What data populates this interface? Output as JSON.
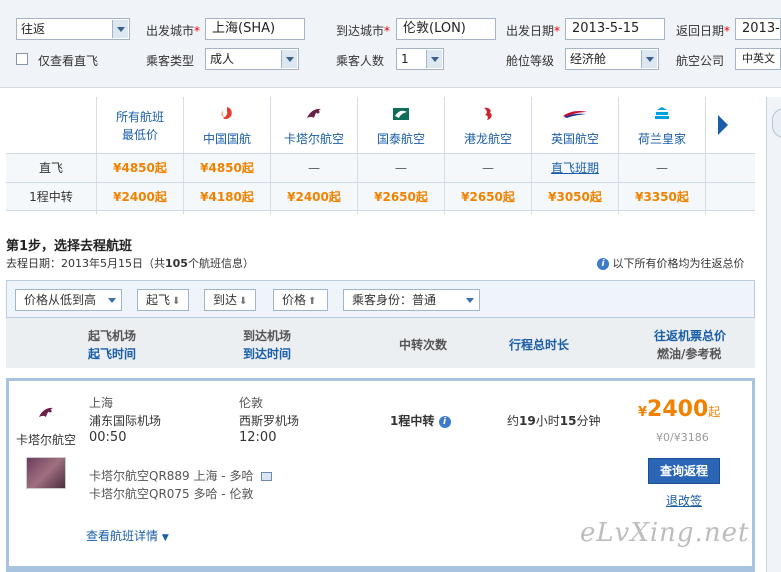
{
  "search": {
    "trip_type": "往返",
    "direct_only_label": "仅查看直飞",
    "depart_city_label": "出发城市",
    "depart_city_value": "上海(SHA)",
    "arrive_city_label": "到达城市",
    "arrive_city_value": "伦敦(LON)",
    "depart_date_label": "出发日期",
    "depart_date_value": "2013-5-15",
    "return_date_label": "返回日期",
    "return_date_value": "2013-5",
    "passenger_type_label": "乘客类型",
    "passenger_type_value": "成人",
    "passenger_count_label": "乘客人数",
    "passenger_count_value": "1",
    "cabin_label": "舱位等级",
    "cabin_value": "经济舱",
    "airline_label": "航空公司",
    "airline_value": "中英文"
  },
  "matrix": {
    "first_col_line1": "所有航班",
    "first_col_line2": "最低价",
    "row_direct": "直飞",
    "row_transfer": "1程中转",
    "all_direct": "¥4850起",
    "all_transfer": "¥2400起",
    "airlines": [
      {
        "name": "中国国航",
        "icon": "air-china-icon",
        "direct": "¥4850起",
        "transfer": "¥4180起"
      },
      {
        "name": "卡塔尔航空",
        "icon": "qatar-icon",
        "direct": "—",
        "transfer": "¥2400起"
      },
      {
        "name": "国泰航空",
        "icon": "cathay-icon",
        "direct": "—",
        "transfer": "¥2650起"
      },
      {
        "name": "港龙航空",
        "icon": "dragonair-icon",
        "direct": "—",
        "transfer": "¥2650起"
      },
      {
        "name": "英国航空",
        "icon": "british-airways-icon",
        "direct": "直飞班期",
        "transfer": "¥3050起"
      },
      {
        "name": "荷兰皇家",
        "icon": "klm-icon",
        "direct": "—",
        "transfer": "¥3350起"
      }
    ]
  },
  "step": {
    "title": "第1步，选择去程航班",
    "date_prefix": "去程日期：2013年5月15日（共",
    "count": "105",
    "date_suffix": "个航班信息）",
    "price_note": "以下所有价格均为往返总价"
  },
  "filters": {
    "sort": "价格从低到高",
    "depart": "起飞",
    "arrive": "到达",
    "price": "价格",
    "passenger": "乘客身份：普通"
  },
  "columns": {
    "dep_airport": "起飞机场",
    "dep_time": "起飞时间",
    "arr_airport": "到达机场",
    "arr_time": "到达时间",
    "stops": "中转次数",
    "duration": "行程总时长",
    "price": "往返机票总价",
    "tax": "燃油/参考税"
  },
  "flight": {
    "airline": "卡塔尔航空",
    "dep_city": "上海",
    "dep_airport": "浦东国际机场",
    "dep_time": "00:50",
    "arr_city": "伦敦",
    "arr_airport": "西斯罗机场",
    "arr_time": "12:00",
    "stops": "1程中转",
    "duration_prefix": "约",
    "duration_hours": "19",
    "duration_mid": "小时",
    "duration_minutes": "15",
    "duration_suffix": "分钟",
    "price_symbol": "¥",
    "price": "2400",
    "price_suffix": "起",
    "tax": "¥0/¥3186",
    "segment1": "卡塔尔航空QR889  上海 - 多哈",
    "segment2": "卡塔尔航空QR075  多哈 - 伦敦",
    "search_return": "查询返程",
    "refund": "退改签",
    "details": "查看航班详情"
  },
  "watermark": "eLvXing.net"
}
